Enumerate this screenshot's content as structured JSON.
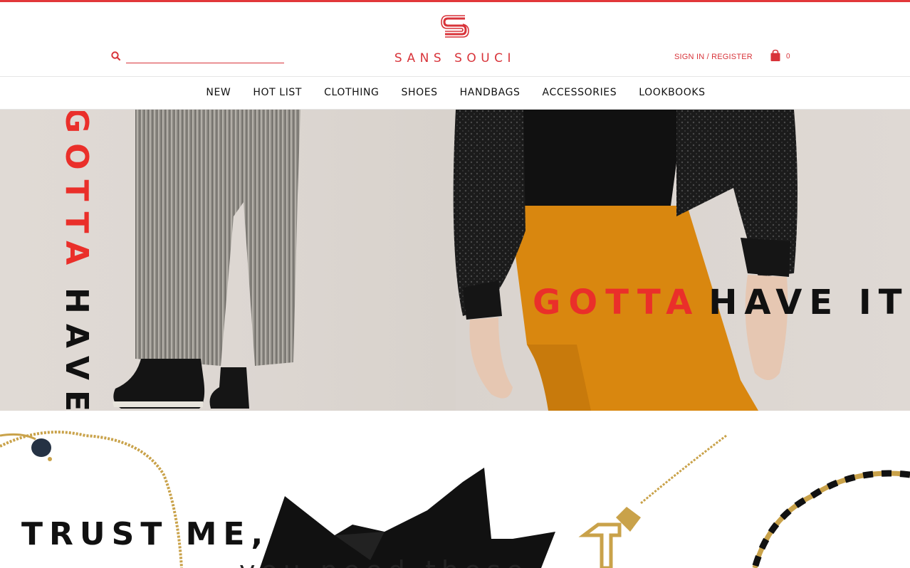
{
  "colors": {
    "accent": "#d8343a",
    "hero_red": "#ea2f2a",
    "text_dark": "#111111"
  },
  "header": {
    "search": {
      "placeholder": "",
      "value": "",
      "icon": "search-icon"
    },
    "logo": {
      "wordmark": "SANS SOUCI",
      "icon": "logo-mark"
    },
    "account": {
      "label": "SIGN IN / REGISTER"
    },
    "cart": {
      "count": "0",
      "icon": "shopping-bag-icon"
    }
  },
  "nav": {
    "items": [
      {
        "label": "NEW"
      },
      {
        "label": "HOT LIST"
      },
      {
        "label": "CLOTHING"
      },
      {
        "label": "SHOES"
      },
      {
        "label": "HANDBAGS"
      },
      {
        "label": "ACCESSORIES"
      },
      {
        "label": "LOOKBOOKS"
      }
    ]
  },
  "hero": {
    "vertical": {
      "red": "GOTTA",
      "black": "HAVE IT"
    },
    "headline": {
      "red": "GOTTA",
      "black": "HAVE IT"
    }
  },
  "promo": {
    "headline": "TRUST ME,",
    "subline": "you need these"
  }
}
